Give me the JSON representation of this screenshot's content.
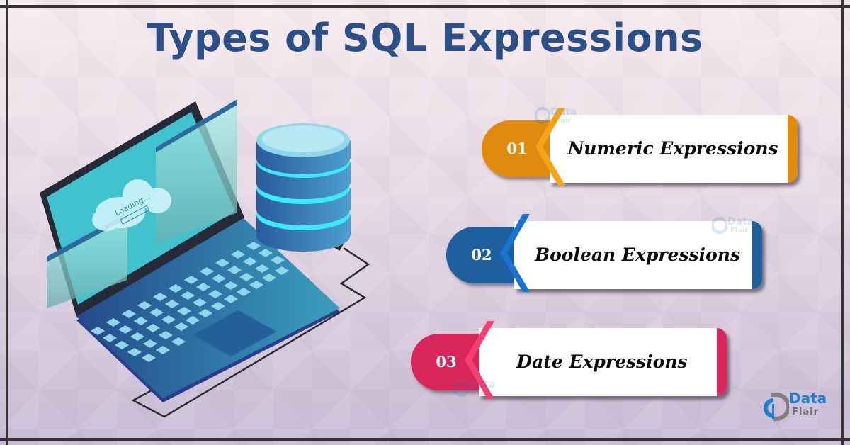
{
  "title": "Types of SQL Expressions",
  "colors": {
    "title": "#2b5088",
    "background_top": "#f7ebee",
    "background_bottom": "#c8bcd6"
  },
  "items": [
    {
      "number": "01",
      "label": "Numeric Expressions",
      "color": "#e08a0e",
      "accent": "#f7a316"
    },
    {
      "number": "02",
      "label": "Boolean Expressions",
      "color": "#1e5f9e",
      "accent": "#1a73d0"
    },
    {
      "number": "03",
      "label": "Date Expressions",
      "color": "#d9265a",
      "accent": "#f53f6e"
    }
  ],
  "illustration": {
    "screen_text": "Loading...",
    "icons": [
      "laptop-icon",
      "database-icon",
      "cloud-icon",
      "cable-icon"
    ]
  },
  "logo": {
    "line1": "Data",
    "line2": "Flair"
  },
  "watermark": {
    "line1": "Data",
    "line2": "Flair"
  }
}
